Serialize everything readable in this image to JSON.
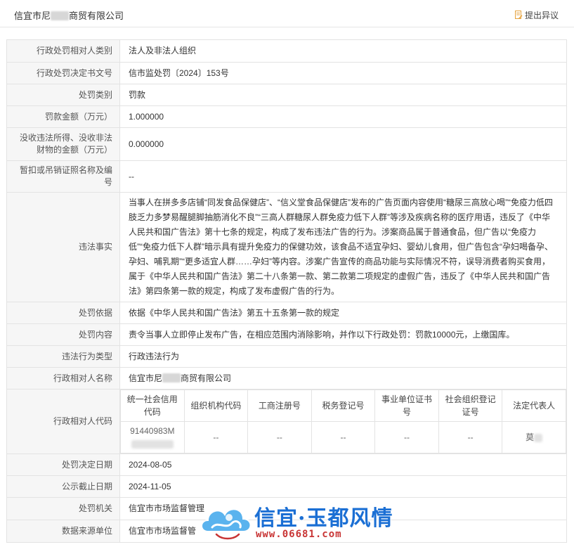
{
  "header": {
    "company_name_prefix": "信宜市尼",
    "company_name_suffix": "商贸有限公司",
    "objection_label": "提出异议"
  },
  "rows": {
    "party_category": {
      "label": "行政处罚相对人类别",
      "value": "法人及非法人组织"
    },
    "decision_no": {
      "label": "行政处罚决定书文号",
      "value": "信市监处罚〔2024〕153号"
    },
    "penalty_type": {
      "label": "处罚类别",
      "value": "罚款"
    },
    "fine_amount": {
      "label": "罚款金额（万元）",
      "value": "1.000000"
    },
    "confiscation_amount": {
      "label": "没收违法所得、没收非法财物的金额（万元）",
      "value": "0.000000"
    },
    "license_suspension": {
      "label": "暂扣或吊销证照名称及编号",
      "value": "--"
    },
    "violation_facts": {
      "label": "违法事实",
      "value": "当事人在拼多多店铺“同发食品保健店”、“信义堂食品保健店”发布的广告页面内容使用“糖尿三高放心喝”“免疫力低四肢乏力多梦易醒腿脚抽筋消化不良”“三高人群糖尿人群免疫力低下人群”等涉及疾病名称的医疗用语，违反了《中华人民共和国广告法》第十七条的规定，构成了发布违法广告的行为。涉案商品属于普通食品，但广告以“免疫力低”“免疫力低下人群”暗示具有提升免疫力的保健功效，该食品不适宜孕妇、婴幼儿食用，但广告包含“孕妇喝备孕、孕妇、哺乳期”“更多适宜人群……孕妇”等内容。涉案广告宣传的商品功能与实际情况不符，误导消费者购买食用，属于《中华人民共和国广告法》第二十八条第一款、第二款第二项规定的虚假广告，违反了《中华人民共和国广告法》第四条第一款的规定，构成了发布虚假广告的行为。"
    },
    "penalty_basis": {
      "label": "处罚依据",
      "value": "依据《中华人民共和国广告法》第五十五条第一款的规定"
    },
    "penalty_content": {
      "label": "处罚内容",
      "value": "责令当事人立即停止发布广告，在相应范围内消除影响，并作以下行政处罚：罚款10000元，上缴国库。"
    },
    "violation_type": {
      "label": "违法行为类型",
      "value": "行政违法行为"
    },
    "party_name": {
      "label": "行政相对人名称",
      "value_prefix": "信宜市尼",
      "value_suffix": "商贸有限公司"
    },
    "party_code": {
      "label": "行政相对人代码",
      "columns": [
        "统一社会信用代码",
        "组织机构代码",
        "工商注册号",
        "税务登记号",
        "事业单位证书号",
        "社会组织登记证号",
        "法定代表人"
      ],
      "values": [
        "91440983M",
        "--",
        "--",
        "--",
        "--",
        "--",
        "莫"
      ]
    },
    "decision_date": {
      "label": "处罚决定日期",
      "value": "2024-08-05"
    },
    "publicity_deadline": {
      "label": "公示截止日期",
      "value": "2024-11-05"
    },
    "penalty_authority": {
      "label": "处罚机关",
      "value": "信宜市市场监督管理"
    },
    "data_source": {
      "label": "数据来源单位",
      "value": "信宜市市场监督管"
    }
  },
  "watermark": {
    "title": "信宜·玉都风情",
    "url": "www.06681.com"
  },
  "colors": {
    "label_bg": "#f6f6f6",
    "border": "#e3e3e3",
    "watermark_blue": "#1b6fd4",
    "watermark_red": "#c83434",
    "objection_icon": "#e6a23c"
  }
}
